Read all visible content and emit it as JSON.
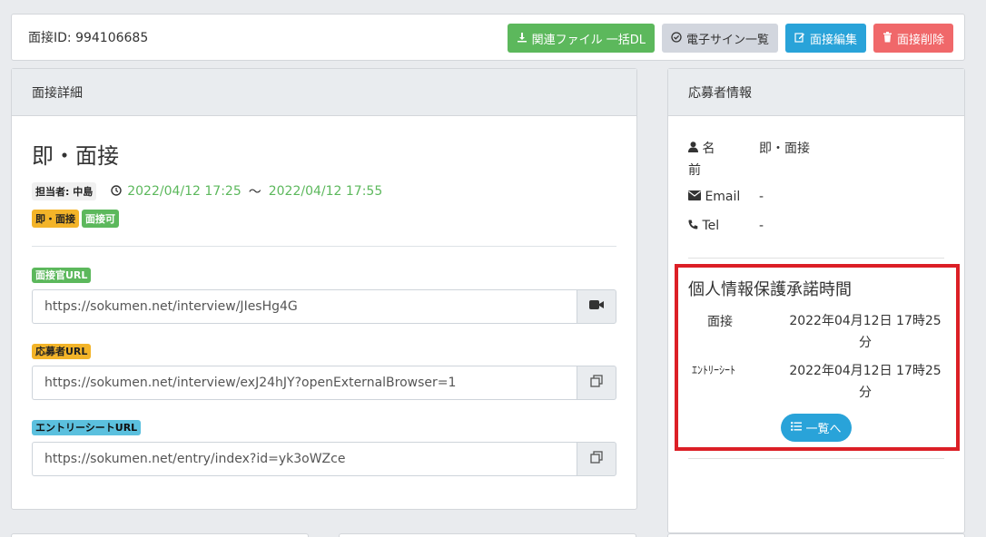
{
  "header": {
    "interview_id_label": "面接ID: 994106685",
    "buttons": {
      "download": "関連ファイル 一括DL",
      "esign": "電子サイン一覧",
      "edit": "面接編集",
      "delete": "面接削除"
    },
    "icons": {
      "download": "download-icon",
      "esign": "check-circle-icon",
      "edit": "edit-icon",
      "delete": "trash-icon"
    }
  },
  "interview_detail": {
    "heading": "面接詳細",
    "title": "即・面接",
    "assignee": "担当者: 中島",
    "start": "2022/04/12 17:25",
    "tilde": "〜",
    "end": "2022/04/12 17:55",
    "tags": [
      "即・面接",
      "面接可"
    ],
    "urls": [
      {
        "label": "面接官URL",
        "value": "https://sokumen.net/interview/JIesHg4G",
        "addon_icon": "video-camera-icon"
      },
      {
        "label": "応募者URL",
        "value": "https://sokumen.net/interview/exJ24hJY?openExternalBrowser=1",
        "addon_icon": "copy-icon"
      },
      {
        "label": "エントリーシートURL",
        "value": "https://sokumen.net/entry/index?id=yk3oWZce",
        "addon_icon": "copy-icon"
      }
    ]
  },
  "applicant": {
    "heading": "応募者情報",
    "name_label_1": "名",
    "name_label_2": "前",
    "name_value": "即・面接",
    "email_label": "Email",
    "email_value": "-",
    "tel_label": "Tel",
    "tel_value": "-"
  },
  "consent": {
    "title": "個人情報保護承諾時間",
    "rows": [
      {
        "label": "面接",
        "value_line1": "2022年04月12日 17時25",
        "value_line2": "分"
      },
      {
        "label": "ｴﾝﾄﾘｰｼｰﾄ",
        "value_line1": "2022年04月12日 17時25",
        "value_line2": "分"
      }
    ],
    "list_button": "一覧へ"
  },
  "colors": {
    "green": "#5cb85c",
    "gray": "#d2d6de",
    "blue": "#29a3d9",
    "red": "#f0686a",
    "highlight": "#dc1f26",
    "yellow": "#f3b429"
  }
}
